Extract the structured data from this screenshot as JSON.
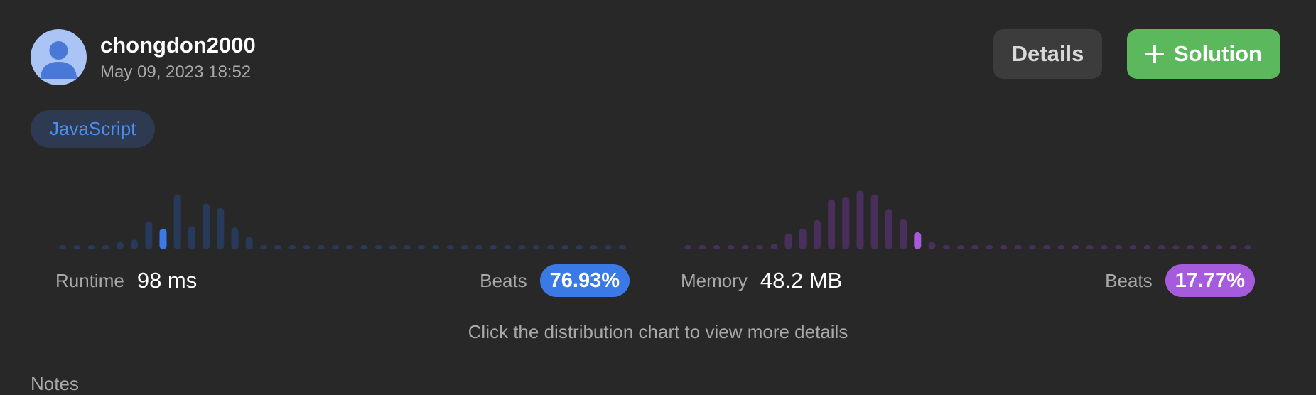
{
  "user": {
    "name": "chongdon2000",
    "timestamp": "May 09, 2023 18:52"
  },
  "actions": {
    "details_label": "Details",
    "solution_label": "Solution"
  },
  "language": "JavaScript",
  "runtime": {
    "label": "Runtime",
    "value": "98 ms",
    "beats_label": "Beats",
    "beats_value": "76.93%",
    "accent": "#3a7ae6",
    "bar_color": "#273a5a",
    "highlight_index": 7,
    "distribution": [
      0.05,
      0.05,
      0.05,
      0.05,
      0.12,
      0.16,
      0.46,
      0.34,
      0.9,
      0.38,
      0.75,
      0.68,
      0.36,
      0.2,
      0.04,
      0.04,
      0.04,
      0.04,
      0.04,
      0.04,
      0.04,
      0.04,
      0.04,
      0.04,
      0.04,
      0.04,
      0.04,
      0.04,
      0.04,
      0.04,
      0.04,
      0.04,
      0.04,
      0.04,
      0.04,
      0.04,
      0.04,
      0.04,
      0.04,
      0.04
    ]
  },
  "memory": {
    "label": "Memory",
    "value": "48.2 MB",
    "beats_label": "Beats",
    "beats_value": "17.77%",
    "accent": "#a65bdc",
    "bar_color": "#4a2e5c",
    "highlight_index": 16,
    "distribution": [
      0.05,
      0.05,
      0.05,
      0.05,
      0.05,
      0.05,
      0.09,
      0.26,
      0.34,
      0.48,
      0.82,
      0.86,
      0.96,
      0.9,
      0.66,
      0.5,
      0.28,
      0.12,
      0.06,
      0.05,
      0.05,
      0.05,
      0.05,
      0.05,
      0.05,
      0.05,
      0.05,
      0.05,
      0.05,
      0.05,
      0.05,
      0.05,
      0.05,
      0.05,
      0.05,
      0.05,
      0.05,
      0.05,
      0.05,
      0.05
    ]
  },
  "hint": "Click the distribution chart to view more details",
  "notes_label": "Notes"
}
